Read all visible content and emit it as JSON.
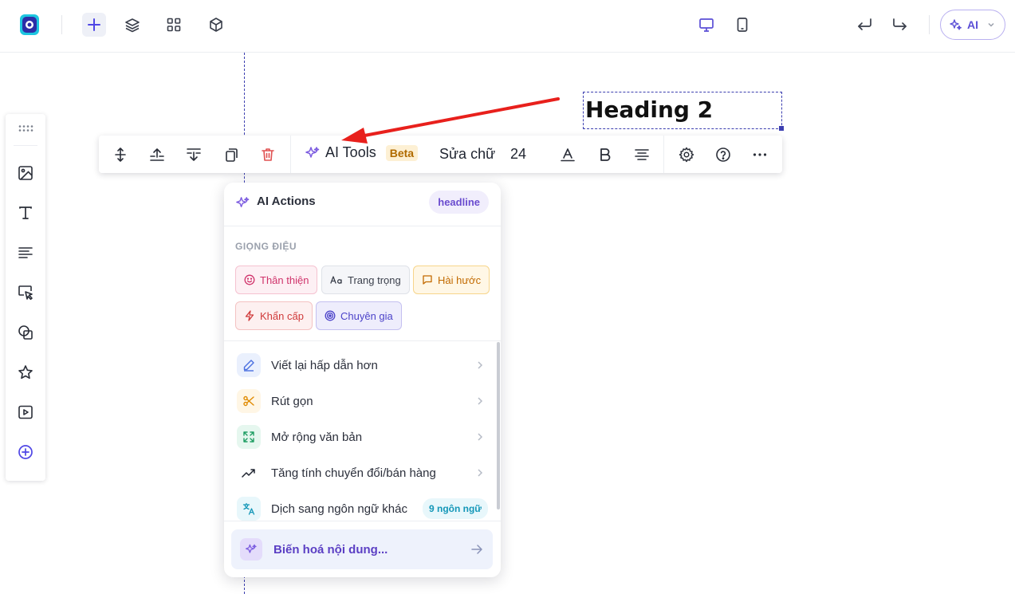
{
  "colors": {
    "accent": "#5b4fd6",
    "danger": "#e05252",
    "arrow": "#e8201c"
  },
  "topbar": {
    "logo_icon": "app-logo",
    "tools": [
      "add-icon",
      "layers-icon",
      "grid-icon",
      "box-icon"
    ],
    "devices": [
      "desktop-icon",
      "tablet-icon"
    ],
    "history": [
      "undo-icon",
      "redo-icon"
    ],
    "ai_button_label": "AI"
  },
  "canvas": {
    "heading_text": "Heading 2"
  },
  "leftbar": {
    "items": [
      "drag-handle-icon",
      "image-icon",
      "text-icon",
      "paragraph-icon",
      "cursor-select-icon",
      "shapes-icon",
      "star-icon",
      "video-icon",
      "add-circle-icon"
    ]
  },
  "toolbar": {
    "ai_tools_label": "AI Tools",
    "beta_label": "Beta",
    "font_label": "Sửa chữ",
    "font_size": "24"
  },
  "panel": {
    "title": "AI Actions",
    "badge": "headline",
    "tone_section_label": "GIỌNG ĐIỆU",
    "tones": [
      {
        "label": "Thân thiện",
        "icon": "smile-icon"
      },
      {
        "label": "Trang trọng",
        "icon": "font-icon"
      },
      {
        "label": "Hài hước",
        "icon": "chat-bubble-icon"
      },
      {
        "label": "Khẩn cấp",
        "icon": "lightning-icon"
      },
      {
        "label": "Chuyên gia",
        "icon": "target-icon"
      }
    ],
    "actions": [
      {
        "label": "Viết lại hấp dẫn hơn",
        "icon": "pencil-icon"
      },
      {
        "label": "Rút gọn",
        "icon": "scissors-icon"
      },
      {
        "label": "Mở rộng văn bản",
        "icon": "expand-icon"
      },
      {
        "label": "Tăng tính chuyển đổi/bán hàng",
        "icon": "trending-up-icon"
      },
      {
        "label": "Dịch sang ngôn ngữ khác",
        "icon": "translate-icon",
        "badge": "9 ngôn ngữ"
      }
    ],
    "transform_label": "Biến hoá nội dung..."
  }
}
